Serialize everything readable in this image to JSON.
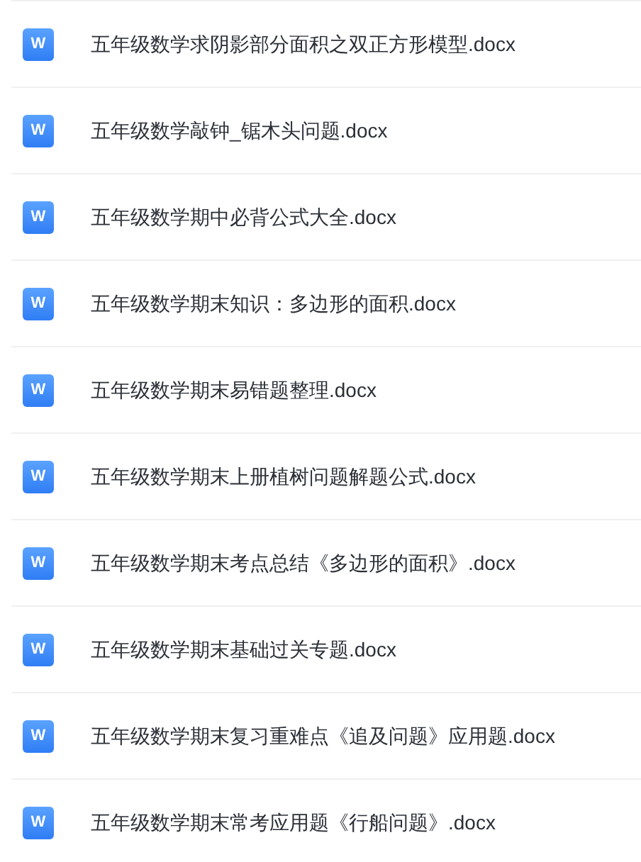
{
  "files": [
    {
      "name": "五年级数学求阴影部分面积之双正方形模型.docx",
      "icon_letter": "W"
    },
    {
      "name": "五年级数学敲钟_锯木头问题.docx",
      "icon_letter": "W"
    },
    {
      "name": "五年级数学期中必背公式大全.docx",
      "icon_letter": "W"
    },
    {
      "name": "五年级数学期末知识：多边形的面积.docx",
      "icon_letter": "W"
    },
    {
      "name": "五年级数学期末易错题整理.docx",
      "icon_letter": "W"
    },
    {
      "name": "五年级数学期末上册植树问题解题公式.docx",
      "icon_letter": "W"
    },
    {
      "name": "五年级数学期末考点总结《多边形的面积》.docx",
      "icon_letter": "W"
    },
    {
      "name": "五年级数学期末基础过关专题.docx",
      "icon_letter": "W"
    },
    {
      "name": "五年级数学期末复习重难点《追及问题》应用题.docx",
      "icon_letter": "W"
    },
    {
      "name": "五年级数学期末常考应用题《行船问题》.docx",
      "icon_letter": "W"
    }
  ]
}
